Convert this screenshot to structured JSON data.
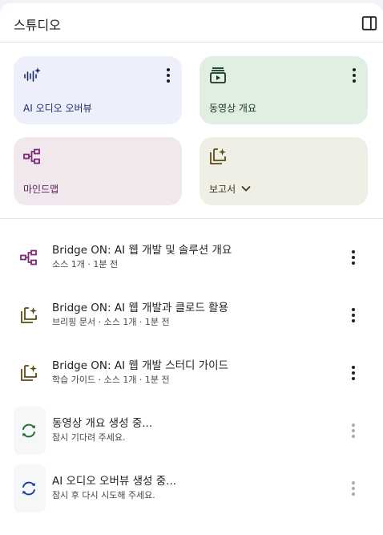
{
  "header": {
    "title": "스튜디오",
    "toggle_icon": "side-panel-icon"
  },
  "tiles": [
    {
      "label": "AI 오디오 오버뷰",
      "icon": "audio-waveform-sparkle-icon",
      "color": "#1a2c6b"
    },
    {
      "label": "동영상 개요",
      "icon": "video-slides-icon",
      "color": "#163a1e"
    },
    {
      "label": "마인드맵",
      "icon": "mind-map-icon",
      "color": "#7b2a73"
    },
    {
      "label": "보고서",
      "icon": "report-sparkle-icon",
      "color": "#5c4b14"
    }
  ],
  "outputs": [
    {
      "title": "Bridge ON: AI 웹 개발 및 솔루션 개요",
      "subtitle": "소스 1개 · 1분 전",
      "icon": "mind-map-icon"
    },
    {
      "title": "Bridge ON: AI 웹 개발과 클로드 활용",
      "subtitle": "브리핑 문서 · 소스 1개 · 1분 전",
      "icon": "report-sparkle-icon"
    },
    {
      "title": "Bridge ON: AI 웹 개발 스터디 가이드",
      "subtitle": "학습 가이드 · 소스 1개 · 1분 전",
      "icon": "report-sparkle-icon"
    },
    {
      "title": "동영상 개요 생성 중...",
      "subtitle": "잠시 기다려 주세요.",
      "icon": "sync-icon",
      "status": "pending",
      "color": "#1e6b2e"
    },
    {
      "title": "AI 오디오 오버뷰 생성 중...",
      "subtitle": "잠시 후 다시 시도해 주세요.",
      "icon": "sync-icon",
      "status": "pending",
      "color": "#1a3fa0"
    }
  ]
}
